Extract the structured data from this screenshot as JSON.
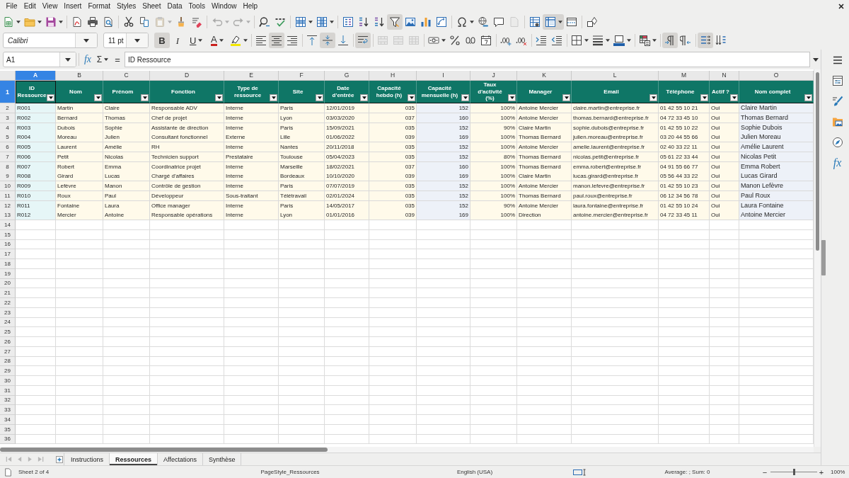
{
  "menu": [
    "File",
    "Edit",
    "View",
    "Insert",
    "Format",
    "Styles",
    "Sheet",
    "Data",
    "Tools",
    "Window",
    "Help"
  ],
  "standard_toolbar": [
    {
      "on": false,
      "disabled": false
    },
    {
      "on": false,
      "disabled": false
    },
    {
      "on": false,
      "disabled": false
    },
    {
      "on": false,
      "disabled": false
    },
    {
      "on": false,
      "disabled": false
    },
    {
      "on": false,
      "disabled": false
    },
    {
      "on": false,
      "disabled": false
    },
    {
      "on": false,
      "disabled": false
    },
    {
      "on": false,
      "disabled": true
    },
    {
      "on": false,
      "disabled": false
    },
    {
      "on": false,
      "disabled": false
    },
    {
      "on": false,
      "disabled": true
    },
    {
      "on": false,
      "disabled": true
    },
    {
      "on": false,
      "disabled": false
    },
    {
      "on": false,
      "disabled": false
    },
    {
      "on": false,
      "disabled": false
    },
    {
      "on": false,
      "disabled": false
    },
    {
      "on": false,
      "disabled": false
    },
    {
      "on": false,
      "disabled": false
    },
    {
      "on": false,
      "disabled": false
    },
    {
      "on": true,
      "disabled": false
    },
    {
      "on": false,
      "disabled": false
    },
    {
      "on": false,
      "disabled": false
    },
    {
      "on": false,
      "disabled": false
    },
    {
      "on": false,
      "disabled": false
    },
    {
      "on": false,
      "disabled": false
    },
    {
      "on": false,
      "disabled": false
    },
    {
      "on": false,
      "disabled": true
    },
    {
      "on": false,
      "disabled": false
    },
    {
      "on": true,
      "disabled": false
    },
    {
      "on": false,
      "disabled": false
    },
    {
      "on": false,
      "disabled": false
    }
  ],
  "formatting_toolbar": {
    "font_name": "Calibri",
    "font_size": "11 pt",
    "buttons": [
      {
        "label": "B",
        "on": true,
        "disabled": false
      },
      {
        "label": "I",
        "on": false,
        "disabled": false
      },
      {
        "label": "U",
        "on": false,
        "disabled": false
      },
      {
        "label": "A",
        "on": false,
        "disabled": false
      },
      {
        "on": false,
        "disabled": false
      },
      {
        "on": false,
        "disabled": false
      },
      {
        "on": true,
        "disabled": false
      },
      {
        "on": false,
        "disabled": false
      },
      {
        "on": false,
        "disabled": false
      },
      {
        "on": true,
        "disabled": false
      },
      {
        "on": false,
        "disabled": false
      },
      {
        "on": true,
        "disabled": false
      },
      {
        "on": false,
        "disabled": true
      },
      {
        "on": false,
        "disabled": true
      },
      {
        "on": false,
        "disabled": true
      },
      {
        "on": false,
        "disabled": false
      },
      {
        "on": false,
        "disabled": false
      },
      {
        "on": false,
        "disabled": false
      },
      {
        "on": false,
        "disabled": false
      },
      {
        "on": false,
        "disabled": false
      },
      {
        "on": false,
        "disabled": false
      },
      {
        "on": false,
        "disabled": false
      },
      {
        "on": false,
        "disabled": false
      },
      {
        "on": false,
        "disabled": false
      },
      {
        "on": false,
        "disabled": false
      },
      {
        "on": false,
        "disabled": false
      },
      {
        "on": false,
        "disabled": false
      },
      {
        "on": true,
        "disabled": false
      },
      {
        "on": false,
        "disabled": false
      },
      {
        "on": true,
        "disabled": false
      },
      {
        "on": false,
        "disabled": false
      }
    ]
  },
  "formula_bar": {
    "name_box": "A1",
    "function_wizard": "fx",
    "sum": "Σ",
    "equals": "=",
    "content": "ID Ressource"
  },
  "column_letters": [
    {
      "label": "A",
      "selected": true
    },
    {
      "label": "B",
      "selected": false
    },
    {
      "label": "C",
      "selected": false
    },
    {
      "label": "D",
      "selected": false
    },
    {
      "label": "E",
      "selected": false
    },
    {
      "label": "F",
      "selected": false
    },
    {
      "label": "G",
      "selected": false
    },
    {
      "label": "H",
      "selected": false
    },
    {
      "label": "I",
      "selected": false
    },
    {
      "label": "J",
      "selected": false
    },
    {
      "label": "K",
      "selected": false
    },
    {
      "label": "L",
      "selected": false
    },
    {
      "label": "M",
      "selected": false
    },
    {
      "label": "N",
      "selected": false
    },
    {
      "label": "O",
      "selected": false
    }
  ],
  "row_numbers": [
    {
      "label": "1",
      "selected": true
    },
    {
      "label": "2",
      "selected": false
    },
    {
      "label": "3",
      "selected": false
    },
    {
      "label": "4",
      "selected": false
    },
    {
      "label": "5",
      "selected": false
    },
    {
      "label": "6",
      "selected": false
    },
    {
      "label": "7",
      "selected": false
    },
    {
      "label": "8",
      "selected": false
    },
    {
      "label": "9",
      "selected": false
    },
    {
      "label": "10",
      "selected": false
    },
    {
      "label": "11",
      "selected": false
    },
    {
      "label": "12",
      "selected": false
    },
    {
      "label": "13",
      "selected": false
    },
    {
      "label": "14",
      "selected": false
    },
    {
      "label": "15",
      "selected": false
    },
    {
      "label": "16",
      "selected": false
    },
    {
      "label": "17",
      "selected": false
    },
    {
      "label": "18",
      "selected": false
    },
    {
      "label": "19",
      "selected": false
    },
    {
      "label": "20",
      "selected": false
    },
    {
      "label": "21",
      "selected": false
    },
    {
      "label": "22",
      "selected": false
    },
    {
      "label": "23",
      "selected": false
    },
    {
      "label": "24",
      "selected": false
    },
    {
      "label": "25",
      "selected": false
    },
    {
      "label": "26",
      "selected": false
    },
    {
      "label": "27",
      "selected": false
    },
    {
      "label": "28",
      "selected": false
    },
    {
      "label": "29",
      "selected": false
    },
    {
      "label": "30",
      "selected": false
    },
    {
      "label": "31",
      "selected": false
    },
    {
      "label": "32",
      "selected": false
    },
    {
      "label": "33",
      "selected": false
    },
    {
      "label": "34",
      "selected": false
    },
    {
      "label": "35",
      "selected": false
    },
    {
      "label": "36",
      "selected": false
    }
  ],
  "header_row": [
    "ID Ressource",
    "Nom",
    "Prénom",
    "Fonction",
    "Type de ressource",
    "Site",
    "Date d'entrée",
    "Capacité hebdo (h)",
    "Capacité mensuelle (h)",
    "Taux d'activité (%)",
    "Manager",
    "Email",
    "Téléphone",
    "Actif ?",
    "Nom complet"
  ],
  "rows": [
    [
      "R001",
      "Martin",
      "Claire",
      "Responsable ADV",
      "Interne",
      "Paris",
      "12/01/2019",
      "035",
      "152",
      "100%",
      "Antoine Mercier",
      "claire.martin@entreprise.fr",
      "01 42 55 10 21",
      "Oui",
      "Claire Martin"
    ],
    [
      "R002",
      "Bernard",
      "Thomas",
      "Chef de projet",
      "Interne",
      "Lyon",
      "03/03/2020",
      "037",
      "160",
      "100%",
      "Antoine Mercier",
      "thomas.bernard@entreprise.fr",
      "04 72 33 45 10",
      "Oui",
      "Thomas Bernard"
    ],
    [
      "R003",
      "Dubois",
      "Sophie",
      "Assistante de direction",
      "Interne",
      "Paris",
      "15/09/2021",
      "035",
      "152",
      "90%",
      "Claire Martin",
      "sophie.dubois@entreprise.fr",
      "01 42 55 10 22",
      "Oui",
      "Sophie Dubois"
    ],
    [
      "R004",
      "Moreau",
      "Julien",
      "Consultant fonctionnel",
      "Externe",
      "Lille",
      "01/06/2022",
      "039",
      "169",
      "100%",
      "Thomas Bernard",
      "julien.moreau@entreprise.fr",
      "03 20 44 55 66",
      "Oui",
      "Julien Moreau"
    ],
    [
      "R005",
      "Laurent",
      "Amélie",
      "RH",
      "Interne",
      "Nantes",
      "20/11/2018",
      "035",
      "152",
      "100%",
      "Antoine Mercier",
      "amelie.laurent@entreprise.fr",
      "02 40 33 22 11",
      "Oui",
      "Amélie Laurent"
    ],
    [
      "R006",
      "Petit",
      "Nicolas",
      "Technicien support",
      "Prestataire",
      "Toulouse",
      "05/04/2023",
      "035",
      "152",
      "80%",
      "Thomas Bernard",
      "nicolas.petit@entreprise.fr",
      "05 61 22 33 44",
      "Oui",
      "Nicolas Petit"
    ],
    [
      "R007",
      "Robert",
      "Emma",
      "Coordinatrice projet",
      "Interne",
      "Marseille",
      "18/02/2021",
      "037",
      "160",
      "100%",
      "Thomas Bernard",
      "emma.robert@entreprise.fr",
      "04 91 55 66 77",
      "Oui",
      "Emma Robert"
    ],
    [
      "R008",
      "Girard",
      "Lucas",
      "Chargé d'affaires",
      "Interne",
      "Bordeaux",
      "10/10/2020",
      "039",
      "169",
      "100%",
      "Claire Martin",
      "lucas.girard@entreprise.fr",
      "05 56 44 33 22",
      "Oui",
      "Lucas Girard"
    ],
    [
      "R009",
      "Lefèvre",
      "Manon",
      "Contrôle de gestion",
      "Interne",
      "Paris",
      "07/07/2019",
      "035",
      "152",
      "100%",
      "Antoine Mercier",
      "manon.lefevre@entreprise.fr",
      "01 42 55 10 23",
      "Oui",
      "Manon Lefèvre"
    ],
    [
      "R010",
      "Roux",
      "Paul",
      "Développeur",
      "Sous-traitant",
      "Télétravail",
      "02/01/2024",
      "035",
      "152",
      "100%",
      "Thomas Bernard",
      "paul.roux@entreprise.fr",
      "06 12 34 56 78",
      "Oui",
      "Paul Roux"
    ],
    [
      "R011",
      "Fontaine",
      "Laura",
      "Office manager",
      "Interne",
      "Paris",
      "14/05/2017",
      "035",
      "152",
      "90%",
      "Antoine Mercier",
      "laura.fontaine@entreprise.fr",
      "01 42 55 10 24",
      "Oui",
      "Laura Fontaine"
    ],
    [
      "R012",
      "Mercier",
      "Antoine",
      "Responsable opérations",
      "Interne",
      "Lyon",
      "01/01/2016",
      "039",
      "169",
      "100%",
      "Direction",
      "antoine.mercier@entreprise.fr",
      "04 72 33 45 11",
      "Oui",
      "Antoine Mercier"
    ]
  ],
  "sheet_navigation": [
    {
      "disabled": true
    },
    {
      "disabled": true
    },
    {
      "disabled": true
    },
    {
      "disabled": true
    }
  ],
  "sheet_tabs": [
    {
      "label": "Instructions",
      "selected": false
    },
    {
      "label": "Ressources",
      "selected": true
    },
    {
      "label": "Affectations",
      "selected": false
    },
    {
      "label": "Synthèse",
      "selected": false
    }
  ],
  "sidebar": {
    "functions": "fx"
  },
  "status_bar": {
    "sheet": "Sheet 2 of 4",
    "page_style": "PageStyle_Ressources",
    "language": "English (USA)",
    "selection_summary": "Average: ; Sum: 0",
    "zoom": {
      "minus": "−",
      "level": 0.5,
      "plus": "+",
      "value": "100%"
    }
  }
}
